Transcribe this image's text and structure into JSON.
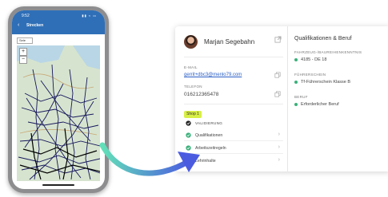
{
  "phone": {
    "status_time": "9:52",
    "status_icons": "▮▮ ≈ ▭",
    "app_title": "Strecken",
    "back_icon": "‹",
    "map_select": "Sele",
    "zoom_in": "+",
    "zoom_out": "−"
  },
  "profile": {
    "name": "Marjan Segebahn",
    "email_label": "E-MAIL",
    "email": "gerrit+dbc3@menlo79.com",
    "phone_label": "TELEFON",
    "phone": "016212365478",
    "shop_badge": "Shop 1",
    "rows": [
      {
        "label": "VALIDIERUNG"
      },
      {
        "label": "Qualifikationen"
      },
      {
        "label": "Arbeitszeitregeln"
      },
      {
        "label": "Lehrinhalte"
      }
    ]
  },
  "qualifications": {
    "title": "Qualifikationen & Beruf",
    "vehicle_label": "FAHRZEUG-/BAUREIHENKENNTNIS",
    "vehicle_value": "4185 - DE 18",
    "license_label": "FÜHRERSCHEIN",
    "license_value": "Tf-Führerschein Klasse B",
    "job_label": "BERUF",
    "job_value": "Erforderlicher Beruf"
  },
  "colors": {
    "app_blue": "#2f6fb7",
    "badge_yellow": "#d8ef45",
    "status_green": "#3ab07a",
    "arrow_start": "#62e0b8",
    "arrow_end": "#4b5be0"
  }
}
